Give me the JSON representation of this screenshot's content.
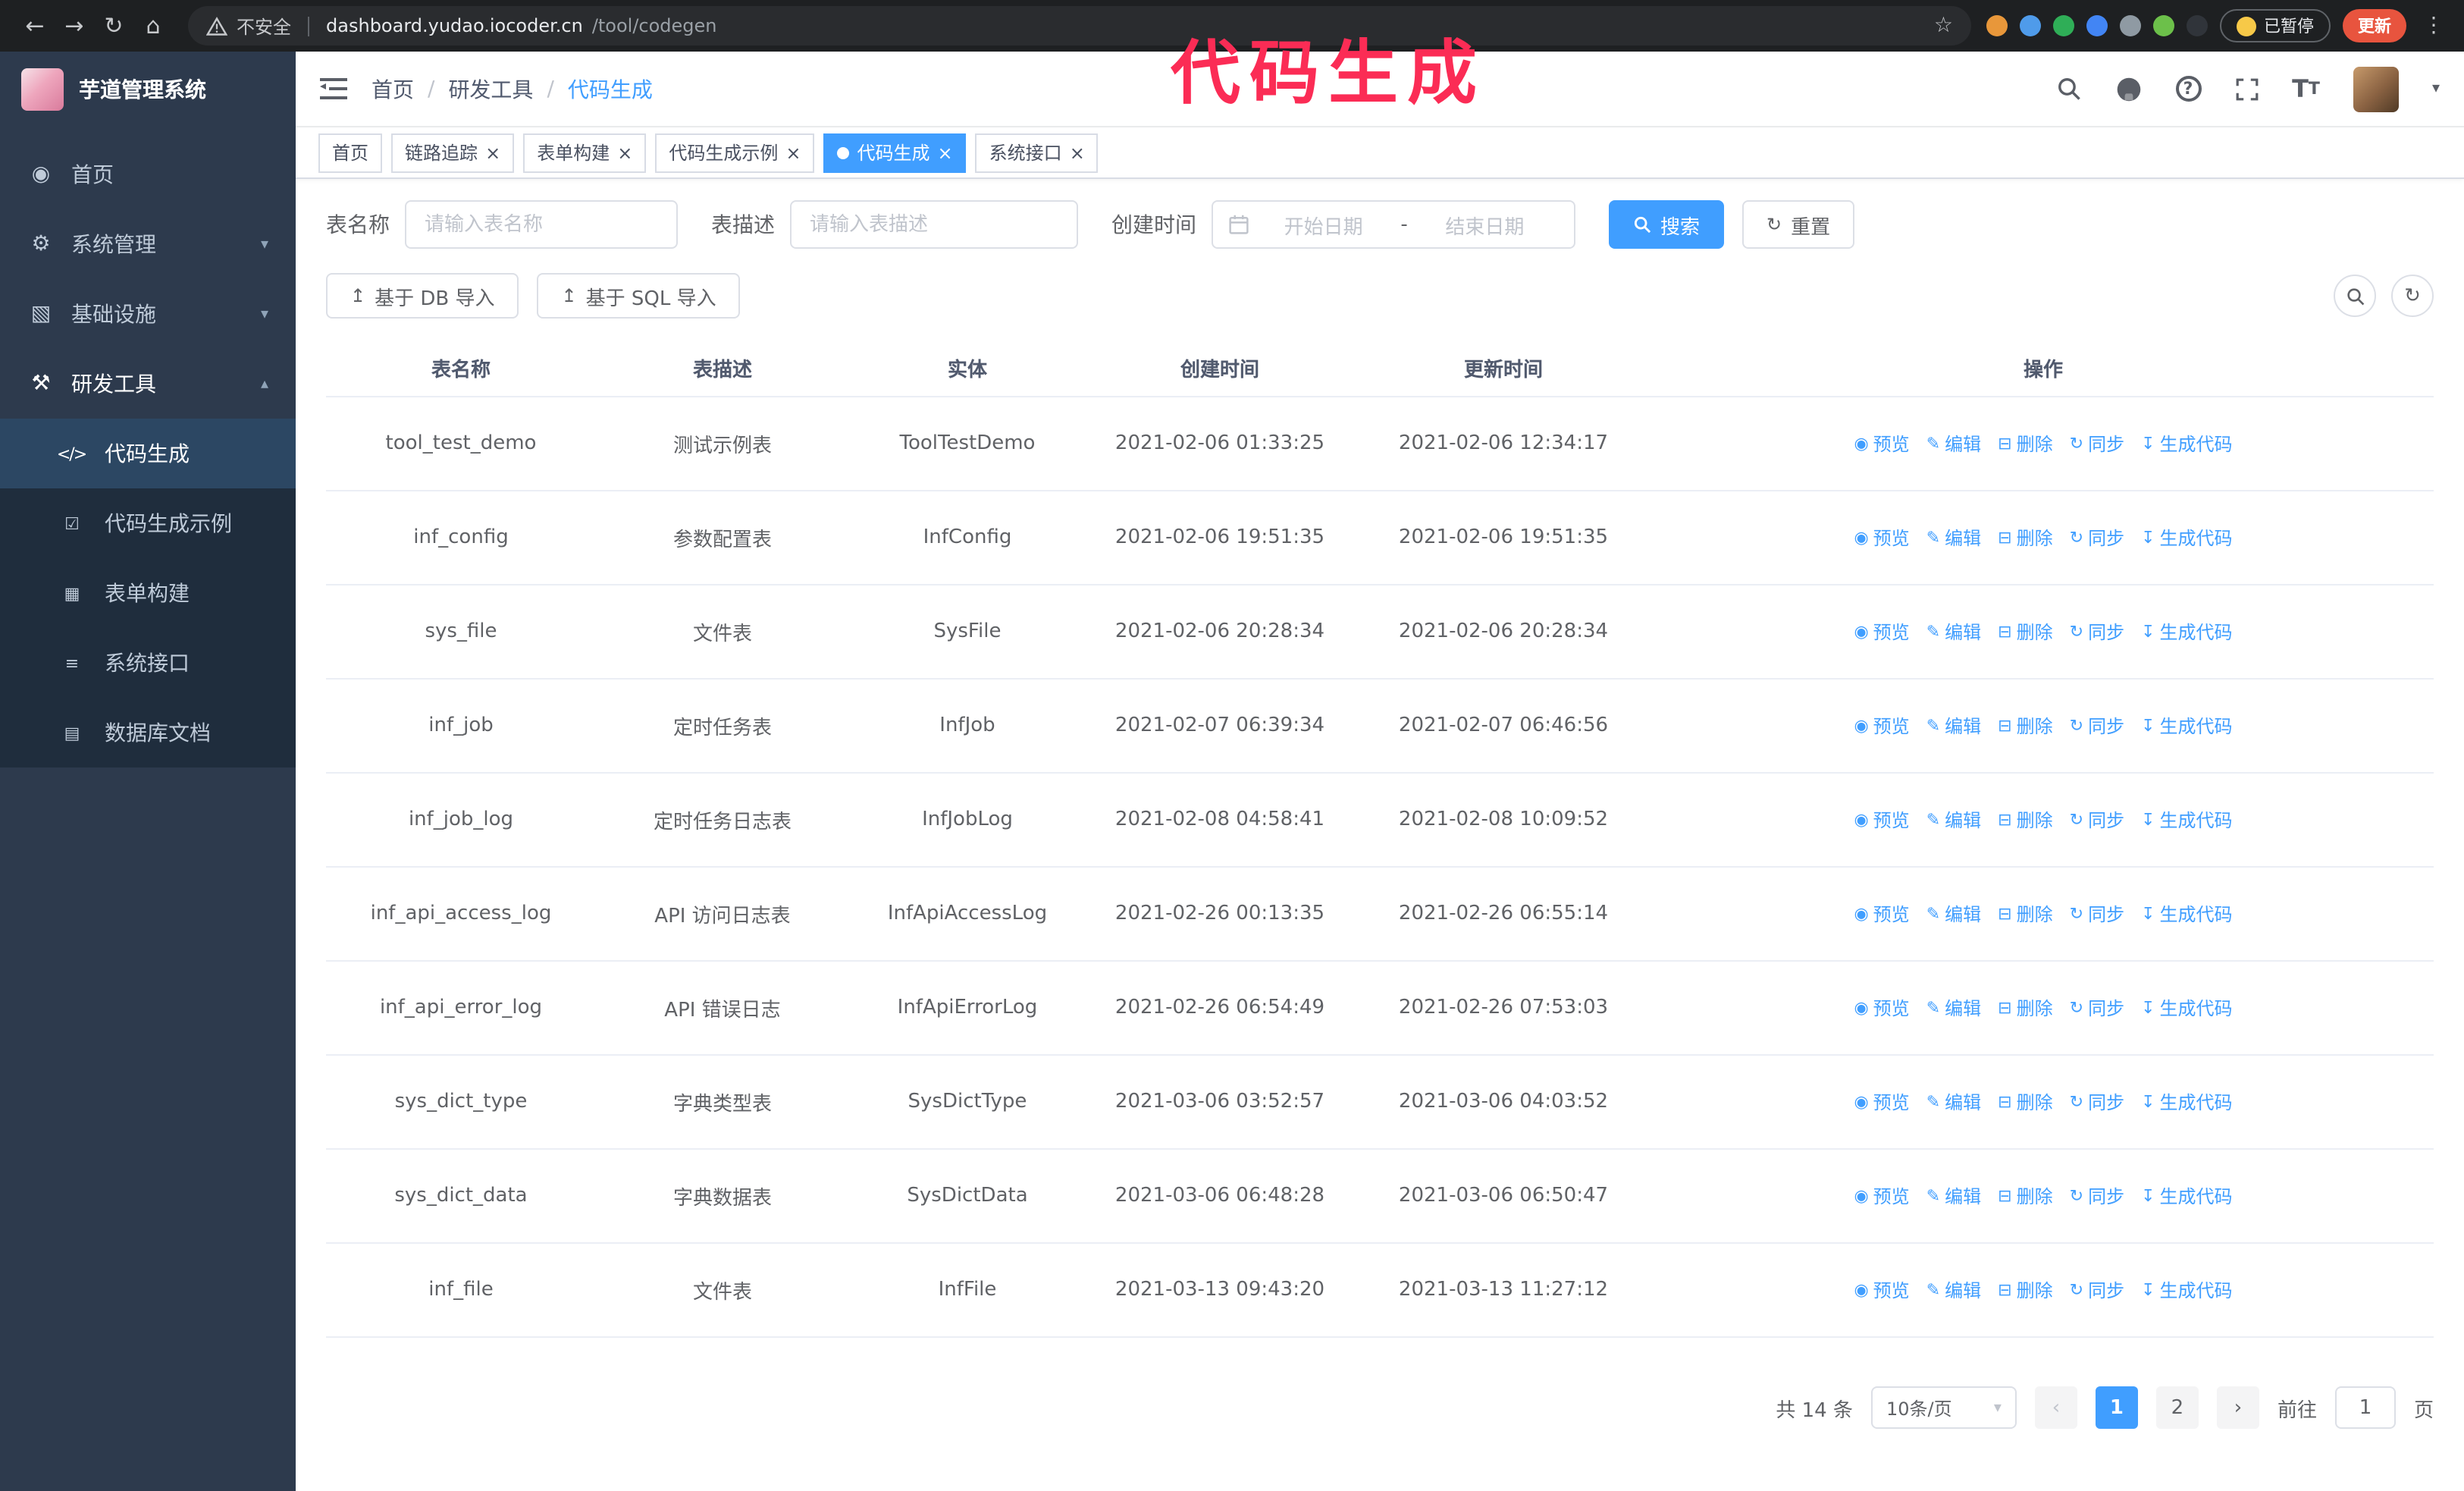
{
  "annotation": {
    "text": "代码生成",
    "color": "#fb2c55"
  },
  "browser": {
    "security_label": "不安全",
    "url_host": "dashboard.yudao.iocoder.cn",
    "url_path": "/tool/codegen",
    "paused_badge": "已暂停",
    "update_button": "更新",
    "extension_colors": [
      "#e8973a",
      "#4f9bea",
      "#2fae57",
      "#4285f4",
      "#8f9aa3",
      "#6cc04a",
      "#30343a"
    ]
  },
  "sidebar": {
    "logo_title": "芋道管理系统",
    "items": [
      {
        "label": "首页",
        "icon": "dashboard-icon",
        "glyph": "◉",
        "chevron": ""
      },
      {
        "label": "系统管理",
        "icon": "gear-icon",
        "glyph": "⚙",
        "chevron": "▾"
      },
      {
        "label": "基础设施",
        "icon": "infrastructure-icon",
        "glyph": "▧",
        "chevron": "▾"
      },
      {
        "label": "研发工具",
        "icon": "tools-icon",
        "glyph": "⚒",
        "chevron": "▴"
      }
    ],
    "subitems": [
      {
        "label": "代码生成",
        "icon": "code-icon",
        "glyph": "</>"
      },
      {
        "label": "代码生成示例",
        "icon": "example-icon",
        "glyph": "☑"
      },
      {
        "label": "表单构建",
        "icon": "form-builder-icon",
        "glyph": "▦"
      },
      {
        "label": "系统接口",
        "icon": "api-icon",
        "glyph": "≡"
      },
      {
        "label": "数据库文档",
        "icon": "database-doc-icon",
        "glyph": "▤"
      }
    ]
  },
  "header": {
    "breadcrumb": [
      "首页",
      "研发工具",
      "代码生成"
    ],
    "separator": "/"
  },
  "tabs": [
    {
      "label": "首页"
    },
    {
      "label": "链路追踪"
    },
    {
      "label": "表单构建"
    },
    {
      "label": "代码生成示例"
    },
    {
      "label": "代码生成"
    },
    {
      "label": "系统接口"
    }
  ],
  "filters": {
    "name_label": "表名称",
    "name_placeholder": "请输入表名称",
    "desc_label": "表描述",
    "desc_placeholder": "请输入表描述",
    "time_label": "创建时间",
    "start_placeholder": "开始日期",
    "range_separator": "-",
    "end_placeholder": "结束日期",
    "search_label": "搜索",
    "reset_label": "重置",
    "reset_glyph": "↻"
  },
  "toolbar": {
    "import_db_label": "基于 DB 导入",
    "import_sql_label": "基于 SQL 导入",
    "upload_glyph": "↥",
    "refresh_glyph": "↻"
  },
  "table": {
    "columns": [
      "表名称",
      "表描述",
      "实体",
      "创建时间",
      "更新时间",
      "操作"
    ],
    "actions": [
      {
        "name": "preview-link",
        "icon": "eye-icon",
        "glyph": "◉",
        "label": "预览"
      },
      {
        "name": "edit-link",
        "icon": "edit-icon",
        "glyph": "✎",
        "label": "编辑"
      },
      {
        "name": "delete-link",
        "icon": "trash-icon",
        "glyph": "⊟",
        "label": "删除"
      },
      {
        "name": "sync-link",
        "icon": "sync-icon",
        "glyph": "↻",
        "label": "同步"
      },
      {
        "name": "generate-code-link",
        "icon": "generate-code-icon",
        "glyph": "↧",
        "label": "生成代码"
      }
    ],
    "rows": [
      {
        "name": "tool_test_demo",
        "desc": "测试示例表",
        "entity": "ToolTestDemo",
        "created": "2021-02-06 01:33:25",
        "updated": "2021-02-06 12:34:17"
      },
      {
        "name": "inf_config",
        "desc": "参数配置表",
        "entity": "InfConfig",
        "created": "2021-02-06 19:51:35",
        "updated": "2021-02-06 19:51:35"
      },
      {
        "name": "sys_file",
        "desc": "文件表",
        "entity": "SysFile",
        "created": "2021-02-06 20:28:34",
        "updated": "2021-02-06 20:28:34"
      },
      {
        "name": "inf_job",
        "desc": "定时任务表",
        "entity": "InfJob",
        "created": "2021-02-07 06:39:34",
        "updated": "2021-02-07 06:46:56"
      },
      {
        "name": "inf_job_log",
        "desc": "定时任务日志表",
        "entity": "InfJobLog",
        "created": "2021-02-08 04:58:41",
        "updated": "2021-02-08 10:09:52"
      },
      {
        "name": "inf_api_access_log",
        "desc": "API 访问日志表",
        "entity": "InfApiAccessLog",
        "created": "2021-02-26 00:13:35",
        "updated": "2021-02-26 06:55:14"
      },
      {
        "name": "inf_api_error_log",
        "desc": "API 错误日志",
        "entity": "InfApiErrorLog",
        "created": "2021-02-26 06:54:49",
        "updated": "2021-02-26 07:53:03"
      },
      {
        "name": "sys_dict_type",
        "desc": "字典类型表",
        "entity": "SysDictType",
        "created": "2021-03-06 03:52:57",
        "updated": "2021-03-06 04:03:52"
      },
      {
        "name": "sys_dict_data",
        "desc": "字典数据表",
        "entity": "SysDictData",
        "created": "2021-03-06 06:48:28",
        "updated": "2021-03-06 06:50:47"
      },
      {
        "name": "inf_file",
        "desc": "文件表",
        "entity": "InfFile",
        "created": "2021-03-13 09:43:20",
        "updated": "2021-03-13 11:27:12"
      }
    ]
  },
  "pagination": {
    "total": "共 14 条",
    "page_size": "10条/页",
    "pages": [
      "1",
      "2"
    ],
    "active_page": "1",
    "prev_glyph": "‹",
    "next_glyph": "›",
    "goto_label": "前往",
    "goto_value": "1",
    "goto_unit": "页"
  }
}
